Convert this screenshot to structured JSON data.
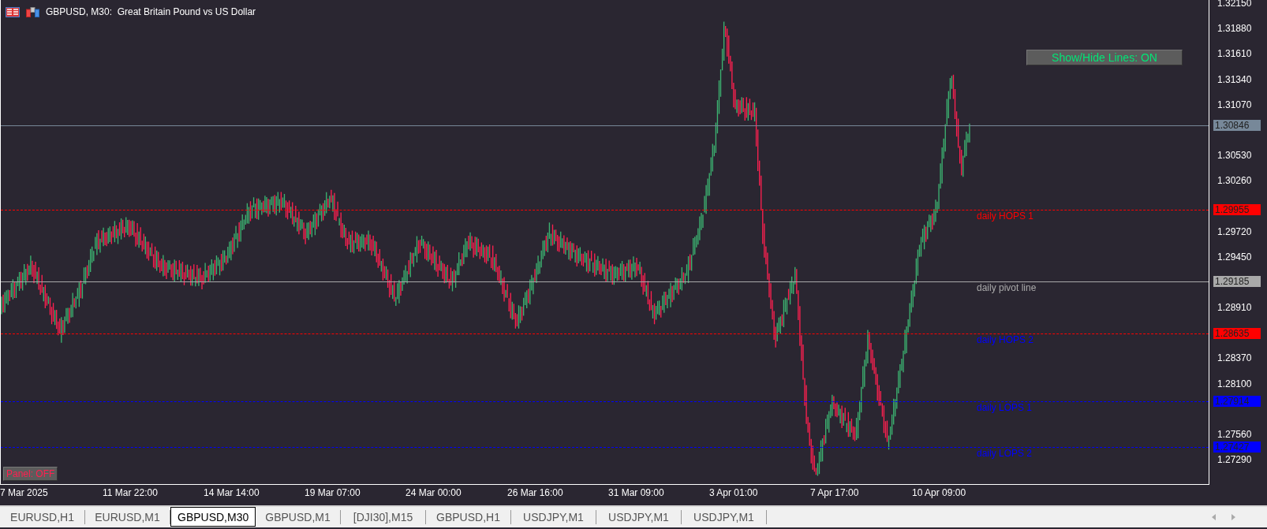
{
  "window": {
    "title": "GBPUSD, M30:  Great Britain Pound vs US Dollar"
  },
  "price_axis": {
    "ticks": [
      "1.32150",
      "1.31880",
      "1.31610",
      "1.31340",
      "1.31070",
      "1.30530",
      "1.30260",
      "1.29720",
      "1.29450",
      "1.28910",
      "1.28370",
      "1.28100",
      "1.27560",
      "1.27290"
    ]
  },
  "time_axis": {
    "ticks": [
      {
        "label": "7 Mar 2025"
      },
      {
        "label": "11 Mar 22:00"
      },
      {
        "label": "14 Mar 14:00"
      },
      {
        "label": "19 Mar 07:00"
      },
      {
        "label": "24 Mar 00:00"
      },
      {
        "label": "26 Mar 16:00"
      },
      {
        "label": "31 Mar 09:00"
      },
      {
        "label": "3 Apr 01:00"
      },
      {
        "label": "7 Apr 17:00"
      },
      {
        "label": "10 Apr 09:00"
      }
    ]
  },
  "levels": [
    {
      "kind": "solid",
      "price": "1.30846",
      "color": "#778899"
    },
    {
      "kind": "dashed",
      "label": {
        "text": "daily HOPS 1",
        "color": "#ff0000"
      },
      "price": "1.29955",
      "color": "#ff0000"
    },
    {
      "kind": "solid",
      "label": {
        "text": "daily pivot line",
        "color": "#a9a9a9"
      },
      "price": "1.29185",
      "color": "#a9a9a9"
    },
    {
      "kind": "dashed",
      "label": {
        "text": "daily HOPS 2",
        "color": "#0000ff"
      },
      "price": "1.28635",
      "color": "#ff0000"
    },
    {
      "kind": "dashed",
      "label": {
        "text": "daily LOPS 1",
        "color": "#0000ff"
      },
      "price": "1.27914",
      "color": "#0000ff"
    },
    {
      "kind": "dashed",
      "label": {
        "text": "daily LOPS 2",
        "color": "#0000ff"
      },
      "price": "1.27427",
      "color": "#0000ff"
    }
  ],
  "toggles": [
    {
      "label": "Show/Hide Lines: ON",
      "on": true
    },
    {
      "label": "Panel: OFF",
      "on": false
    }
  ],
  "tabs": [
    {
      "label": "EURUSD,H1",
      "selected": false
    },
    {
      "label": "EURUSD,M1",
      "selected": false
    },
    {
      "label": "GBPUSD,M30",
      "selected": true
    },
    {
      "label": "GBPUSD,M1",
      "selected": false
    },
    {
      "label": "[DJI30],M15",
      "selected": false
    },
    {
      "label": "GBPUSD,H1",
      "selected": false
    },
    {
      "label": "USDJPY,M1",
      "selected": false
    },
    {
      "label": "USDJPY,M1",
      "selected": false
    },
    {
      "label": "USDJPY,M1",
      "selected": false
    }
  ]
}
